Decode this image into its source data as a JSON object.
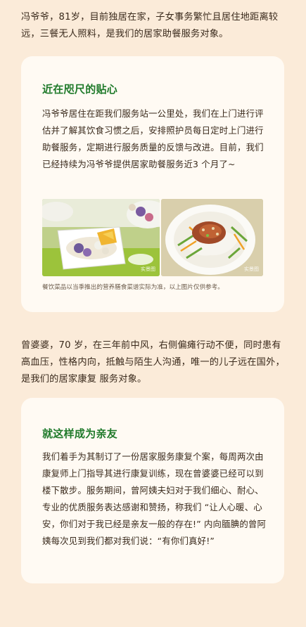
{
  "section1": {
    "intro": "冯爷爷，81岁，目前独居在家，子女事务繁忙且居住地距离较远，三餐无人照料，是我们的居家助餐服务对象。",
    "card": {
      "title": "近在咫尺的贴心",
      "body": "冯爷爷居住在距我们服务站一公里处，我们在上门进行评估并了解其饮食习惯之后，安排照护员每日定时上门进行助餐服务，定期进行服务质量的反馈与改进。目前，我们已经持续为冯爷爷提供居家助餐服务近3 个月了~",
      "photo1_watermark": "实景图",
      "photo2_watermark": "实景图",
      "caption": "餐饮菜品以当季推出的营养膳食菜谱实际为准，以上图片仅供参考。"
    }
  },
  "section2": {
    "intro": "曾婆婆，70 岁，在三年前中风，右侧偏瘫行动不便，同时患有高血压，性格内向，抵触与陌生人沟通，唯一的儿子远在国外，是我们的居家康复 服务对象。",
    "card": {
      "title": "就这样成为亲友",
      "body": "我们着手为其制订了一份居家服务康复个案，每周两次由康复师上门指导其进行康复训练，现在曾婆婆已经可以到楼下散步。服务期间，曾阿姨夫妇对于我们细心、耐心、专业的优质服务表达感谢和赞扬，称我们 “让人心暖、心安，你们对于我已经是亲友一般的存在!” 内向腼腆的曾阿姨每次见到我们都对我们说：“有你们真好!”"
    }
  },
  "colors": {
    "background": "#fbebd9",
    "card": "#fffaf3",
    "title_green": "#1f7a2a",
    "text": "#3a2a1c"
  }
}
